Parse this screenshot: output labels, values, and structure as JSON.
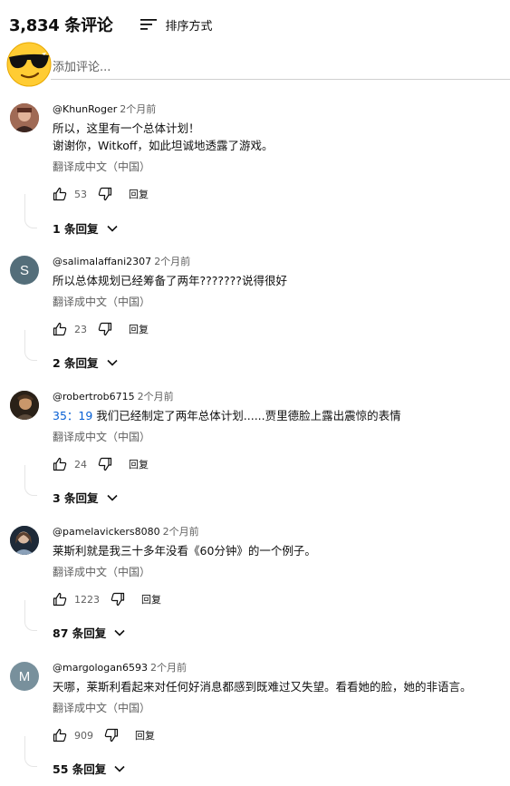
{
  "header": {
    "count_title": "3,834 条评论",
    "sort_label": "排序方式"
  },
  "add_comment": {
    "placeholder": "添加评论..."
  },
  "comments": [
    {
      "handle": "@KhunRoger",
      "time": "2个月前",
      "text_line1": "所以，这里有一个总体计划！",
      "text_line2": "谢谢你，Witkoff，如此坦诚地透露了游戏。",
      "translate": "翻译成中文（中国）",
      "likes": "53",
      "reply": "回复",
      "replies": "1 条回复"
    },
    {
      "handle": "@salimalaffani2307",
      "time": "2个月前",
      "avatar_letter": "S",
      "avatar_color": "#546e7a",
      "text": "所以总体规划已经筹备了两年???????说得很好",
      "translate": "翻译成中文（中国）",
      "likes": "23",
      "reply": "回复",
      "replies": "2 条回复"
    },
    {
      "handle": "@robertrob6715",
      "time": "2个月前",
      "timestamp_link": "35：19",
      "text": " 我们已经制定了两年总体计划......贾里德脸上露出震惊的表情",
      "translate": "翻译成中文（中国）",
      "likes": "24",
      "reply": "回复",
      "replies": "3 条回复"
    },
    {
      "handle": "@pamelavickers8080",
      "time": "2个月前",
      "text": "莱斯利就是我三十多年没看《60分钟》的一个例子。",
      "translate": "翻译成中文（中国）",
      "likes": "1223",
      "reply": "回复",
      "replies": "87 条回复"
    },
    {
      "handle": "@margologan6593",
      "time": "2个月前",
      "avatar_letter": "M",
      "avatar_color": "#78909c",
      "text": "天哪，莱斯利看起来对任何好消息都感到既难过又失望。看看她的脸，她的非语言。",
      "translate": "翻译成中文（中国）",
      "likes": "909",
      "reply": "回复",
      "replies": "55 条回复"
    }
  ],
  "colors": {
    "link": "#065fd4",
    "secondary_text": "#606060",
    "primary_text": "#0f0f0f"
  }
}
